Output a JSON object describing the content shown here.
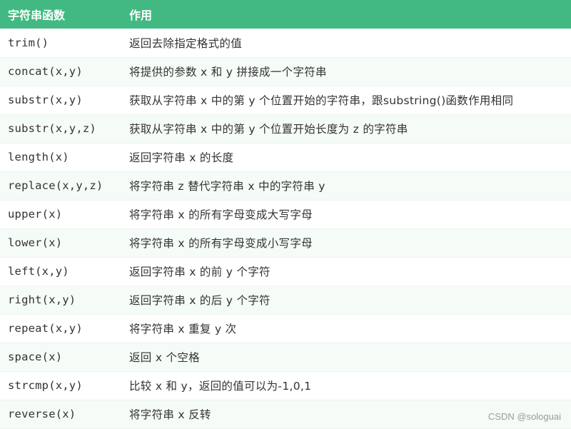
{
  "header": {
    "function_col": "字符串函数",
    "usage_col": "作用"
  },
  "rows": [
    {
      "func": "trim()",
      "desc": "返回去除指定格式的值"
    },
    {
      "func": "concat(x,y)",
      "desc": "将提供的参数 x 和 y 拼接成一个字符串"
    },
    {
      "func": "substr(x,y)",
      "desc": "获取从字符串 x 中的第 y 个位置开始的字符串，跟substring()函数作用相同"
    },
    {
      "func": "substr(x,y,z)",
      "desc": "获取从字符串 x 中的第 y 个位置开始长度为 z 的字符串"
    },
    {
      "func": "length(x)",
      "desc": "返回字符串 x 的长度"
    },
    {
      "func": "replace(x,y,z)",
      "desc": "将字符串 z 替代字符串 x 中的字符串 y"
    },
    {
      "func": "upper(x)",
      "desc": "将字符串 x 的所有字母变成大写字母"
    },
    {
      "func": "lower(x)",
      "desc": "将字符串 x 的所有字母变成小写字母"
    },
    {
      "func": "left(x,y)",
      "desc": "返回字符串 x 的前 y 个字符"
    },
    {
      "func": "right(x,y)",
      "desc": "返回字符串 x 的后 y 个字符"
    },
    {
      "func": "repeat(x,y)",
      "desc": "将字符串 x 重复 y 次"
    },
    {
      "func": "space(x)",
      "desc": "返回 x 个空格"
    },
    {
      "func": "strcmp(x,y)",
      "desc": "比较 x 和 y，返回的值可以为-1,0,1"
    },
    {
      "func": "reverse(x)",
      "desc": "将字符串 x 反转"
    }
  ],
  "watermark": "CSDN @sologuai",
  "colors": {
    "header_bg": "#42b983",
    "header_text": "#ffffff",
    "alt_row_bg": "#f5fbf7"
  }
}
